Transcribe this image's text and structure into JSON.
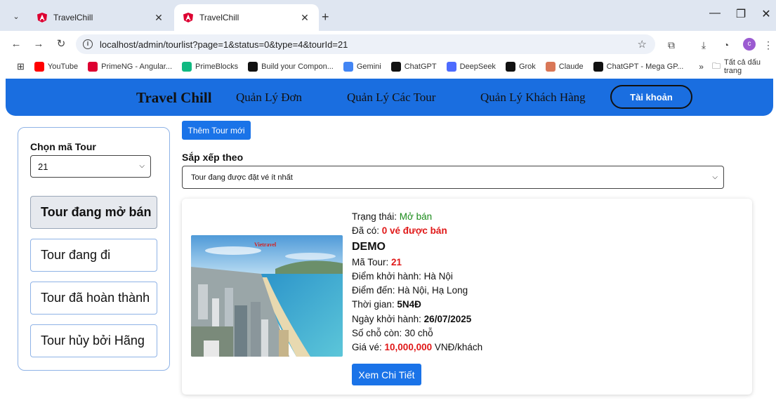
{
  "browser": {
    "tabs": [
      {
        "title": "TravelChill",
        "active": false
      },
      {
        "title": "TravelChill",
        "active": true
      }
    ],
    "url": "localhost/admin/tourlist?page=1&status=0&type=4&tourId=21",
    "profile_initial": "c",
    "bookmarks": [
      {
        "label": "YouTube",
        "color": "#ff0000"
      },
      {
        "label": "PrimeNG - Angular...",
        "color": "#dd0031"
      },
      {
        "label": "PrimeBlocks",
        "color": "#10b981"
      },
      {
        "label": "Build your Compon...",
        "color": "#111111"
      },
      {
        "label": "Gemini",
        "color": "#4285f4"
      },
      {
        "label": "ChatGPT",
        "color": "#111111"
      },
      {
        "label": "DeepSeek",
        "color": "#4d6bfe"
      },
      {
        "label": "Grok",
        "color": "#111111"
      },
      {
        "label": "Claude",
        "color": "#d97757"
      },
      {
        "label": "ChatGPT - Mega GP...",
        "color": "#111111"
      }
    ],
    "bookmarks_overflow": "»",
    "all_bookmarks": "Tất cả dấu trang"
  },
  "nav": {
    "brand": "Travel Chill",
    "links": [
      "Quản Lý Đơn",
      "Quản Lý Các Tour",
      "Quản Lý Khách Hàng"
    ],
    "account": "Tài khoản"
  },
  "sidebar": {
    "label": "Chọn mã Tour",
    "selected_tour": "21",
    "items": [
      {
        "label": "Tour đang mở bán",
        "active": true
      },
      {
        "label": "Tour đang đi",
        "active": false
      },
      {
        "label": "Tour đã hoàn thành",
        "active": false
      },
      {
        "label": "Tour hủy bởi Hãng",
        "active": false
      }
    ]
  },
  "main": {
    "add_button": "Thêm Tour mới",
    "sort_label": "Sắp xếp theo",
    "sort_value": "Tour đang được đặt vé ít nhất"
  },
  "tour": {
    "status_label": "Trạng thái: ",
    "status_value": "Mở bán",
    "sold_label": "Đã có: ",
    "sold_value": "0 vé được bán",
    "name": "DEMO",
    "code_label": "Mã Tour: ",
    "code_value": "21",
    "departure_label": "Điểm khởi hành: ",
    "departure_value": "Hà Nội",
    "destination_label": "Điểm đến: ",
    "destination_value": "Hà Nội, Hạ Long",
    "duration_label": "Thời gian: ",
    "duration_value": "5N4Đ",
    "start_date_label": "Ngày khởi hành: ",
    "start_date_value": "26/07/2025",
    "seats_label": "Số chỗ còn: ",
    "seats_value": "30 chỗ",
    "price_label": "Giá vé: ",
    "price_value": "10,000,000",
    "price_unit": " VNĐ/khách",
    "detail_button": "Xem Chi Tiết",
    "image_logo": "Vietravel"
  },
  "colors": {
    "nav_bg": "#1a6ee0",
    "primary_button": "#1a73e8",
    "status_green": "#1a8a1a",
    "highlight_red": "#e01818"
  }
}
